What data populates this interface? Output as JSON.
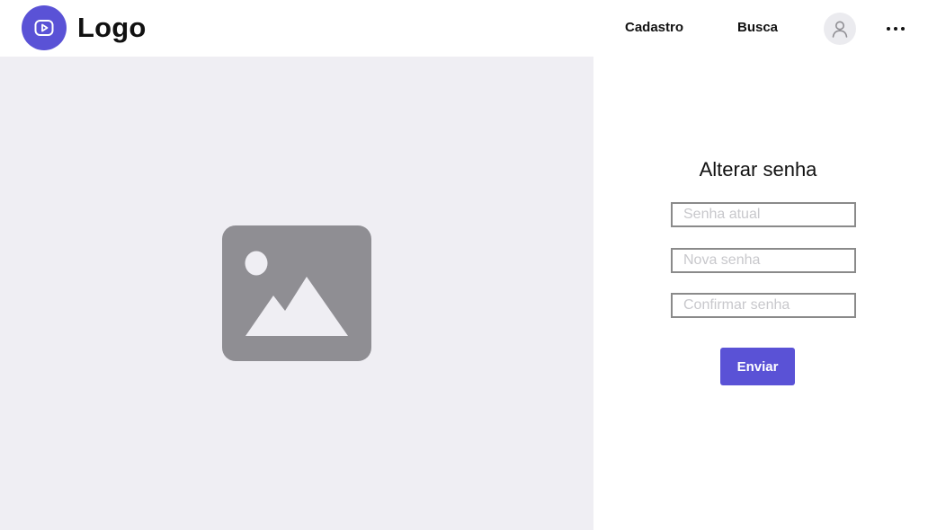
{
  "header": {
    "logo_text": "Logo",
    "logo_icon": "play-icon",
    "nav": [
      {
        "label": "Cadastro"
      },
      {
        "label": "Busca"
      }
    ],
    "avatar_icon": "user-icon",
    "more_icon": "more-horizontal-icon"
  },
  "image_panel": {
    "icon": "image-placeholder-icon"
  },
  "form": {
    "title": "Alterar senha",
    "fields": [
      {
        "placeholder": "Senha atual",
        "value": ""
      },
      {
        "placeholder": "Nova senha",
        "value": ""
      },
      {
        "placeholder": "Confirmar senha",
        "value": ""
      }
    ],
    "submit_label": "Enviar"
  },
  "colors": {
    "accent": "#5a52d6",
    "panel_bg": "#efeef3",
    "placeholder_icon": "#8f8e93"
  }
}
